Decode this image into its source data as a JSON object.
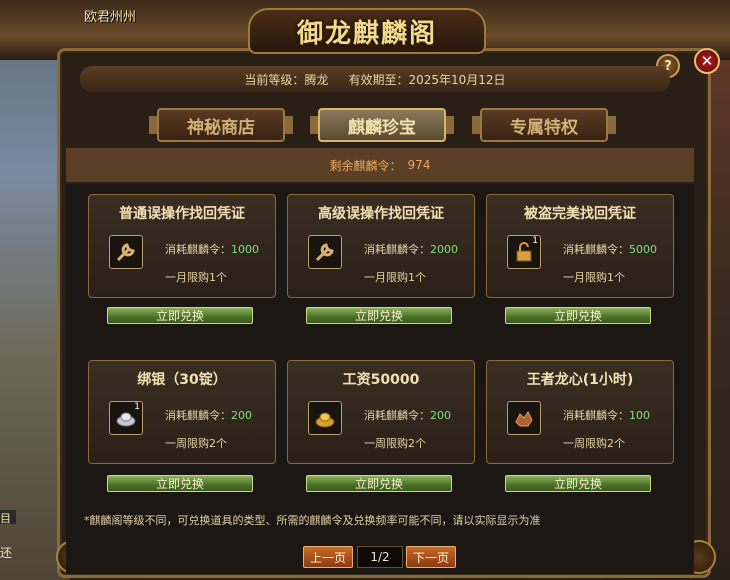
{
  "player_name": "欧君州州",
  "edge_text": [
    "目",
    "还"
  ],
  "window": {
    "title": "御龙麒麟阁",
    "help_label": "?",
    "close_label": "✕"
  },
  "header": {
    "level_label": "当前等级：",
    "level_value": "腾龙",
    "expiry_label": "有效期至：",
    "expiry_value": "2025年10月12日"
  },
  "tabs": [
    {
      "label": "神秘商店",
      "active": false
    },
    {
      "label": "麒麟珍宝",
      "active": true
    },
    {
      "label": "专属特权",
      "active": false
    }
  ],
  "remaining": {
    "label": "剩余麒麟令：",
    "value": "974"
  },
  "items": [
    {
      "title": "普通误操作找回凭证",
      "icon": "wrench-icon",
      "qty": "",
      "cost_label": "消耗麒麟令：",
      "cost": "1000",
      "limit": "一月限购1个",
      "button": "立即兑换"
    },
    {
      "title": "高级误操作找回凭证",
      "icon": "wrench-icon",
      "qty": "",
      "cost_label": "消耗麒麟令：",
      "cost": "2000",
      "limit": "一月限购1个",
      "button": "立即兑换"
    },
    {
      "title": "被盗完美找回凭证",
      "icon": "padlock-icon",
      "qty": "1",
      "cost_label": "消耗麒麟令：",
      "cost": "5000",
      "limit": "一月限购1个",
      "button": "立即兑换"
    },
    {
      "title": "绑银（30锭）",
      "icon": "silver-ingot-icon",
      "qty": "1",
      "cost_label": "消耗麒麟令：",
      "cost": "200",
      "limit": "一周限购2个",
      "button": "立即兑换"
    },
    {
      "title": "工资50000",
      "icon": "gold-ingot-icon",
      "qty": "",
      "cost_label": "消耗麒麟令：",
      "cost": "200",
      "limit": "一周限购2个",
      "button": "立即兑换"
    },
    {
      "title": "王者龙心(1小时)",
      "icon": "dragon-heart-icon",
      "qty": "",
      "cost_label": "消耗麒麟令：",
      "cost": "100",
      "limit": "一周限购2个",
      "button": "立即兑换"
    }
  ],
  "note": "*麒麟阁等级不同，可兑换道具的类型、所需的麒麟令及兑换频率可能不同，请以实际显示为准",
  "pagination": {
    "prev": "上一页",
    "page": "1/2",
    "next": "下一页"
  }
}
